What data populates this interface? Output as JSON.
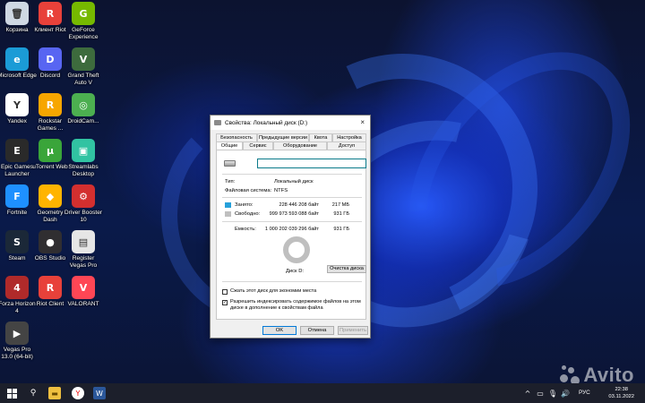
{
  "desktop": {
    "icons": [
      {
        "label": "Корзина",
        "glyph": "🗑",
        "color": "#cfd8e3",
        "icon": "recycle-bin-icon"
      },
      {
        "label": "Клиент Riot",
        "glyph": "R",
        "color": "#e8413a",
        "icon": "riot-client-icon"
      },
      {
        "label": "GeForce Experience",
        "glyph": "G",
        "color": "#76b900",
        "icon": "geforce-icon"
      },
      {
        "label": "Microsoft Edge",
        "glyph": "e",
        "color": "#1b9bd6",
        "icon": "edge-icon"
      },
      {
        "label": "Discord",
        "glyph": "D",
        "color": "#5865f2",
        "icon": "discord-icon"
      },
      {
        "label": "Grand Theft Auto V",
        "glyph": "V",
        "color": "#3d6b3d",
        "icon": "gta-icon"
      },
      {
        "label": "Yandex",
        "glyph": "Y",
        "color": "#ffffff",
        "icon": "yandex-icon"
      },
      {
        "label": "Rockstar Games ...",
        "glyph": "R",
        "color": "#f7a600",
        "icon": "rockstar-icon"
      },
      {
        "label": "DroidCam...",
        "glyph": "◎",
        "color": "#4caf50",
        "icon": "droidcam-icon"
      },
      {
        "label": "Epic Games Launcher",
        "glyph": "E",
        "color": "#2a2a2a",
        "icon": "epic-games-icon"
      },
      {
        "label": "uTorrent Web",
        "glyph": "µ",
        "color": "#3aa53a",
        "icon": "utorrent-icon"
      },
      {
        "label": "Streamlabs Desktop",
        "glyph": "▣",
        "color": "#31c3a2",
        "icon": "streamlabs-icon"
      },
      {
        "label": "Fortnite",
        "glyph": "F",
        "color": "#1e90ff",
        "icon": "fortnite-icon"
      },
      {
        "label": "Geometry Dash",
        "glyph": "◆",
        "color": "#ffb400",
        "icon": "geometry-dash-icon"
      },
      {
        "label": "Driver Booster 10",
        "glyph": "⚙",
        "color": "#d32f2f",
        "icon": "driver-booster-icon"
      },
      {
        "label": "Steam",
        "glyph": "S",
        "color": "#1b2838",
        "icon": "steam-icon"
      },
      {
        "label": "OBS Studio",
        "glyph": "●",
        "color": "#302e31",
        "icon": "obs-icon"
      },
      {
        "label": "Register Vegas Pro",
        "glyph": "▤",
        "color": "#e6e6e6",
        "icon": "register-vegas-icon"
      },
      {
        "label": "Forza Horizon 4",
        "glyph": "4",
        "color": "#b02a2a",
        "icon": "forza-icon"
      },
      {
        "label": "Riot Client",
        "glyph": "R",
        "color": "#e8413a",
        "icon": "riot-client-icon"
      },
      {
        "label": "VALORANT",
        "glyph": "V",
        "color": "#ff4655",
        "icon": "valorant-icon"
      },
      {
        "label": "Vegas Pro 13.0 (64-bit)",
        "glyph": "▶",
        "color": "#444444",
        "icon": "vegas-pro-icon"
      }
    ]
  },
  "dialog": {
    "title": "Свойства: Локальный диск (D:)",
    "close": "×",
    "tabs_row1": [
      "Безопасность",
      "Предыдущие версии",
      "Квота",
      "Настройка"
    ],
    "tabs_row2": [
      "Общие",
      "Сервис",
      "Оборудование",
      "Доступ"
    ],
    "active_tab": "Общие",
    "name_value": "",
    "type_label": "Тип:",
    "type_value": "Локальный диск",
    "fs_label": "Файловая система:",
    "fs_value": "NTFS",
    "used_label": "Занято:",
    "used_bytes": "228 446 208 байт",
    "used_size": "217 МБ",
    "free_label": "Свободно:",
    "free_bytes": "999 973 593 088 байт",
    "free_size": "931 ГБ",
    "capacity_label": "Емкость:",
    "capacity_bytes": "1 000 202 039 296 байт",
    "capacity_size": "931 ГБ",
    "disk_label": "Диск D:",
    "cleanup_button": "Очистка диска",
    "compress_label": "Сжать этот диск для экономии места",
    "compress_checked": false,
    "index_label": "Разрешить индексировать содержимое файлов на этом диске в дополнение к свойствам файла",
    "index_checked": true,
    "ok_button": "OK",
    "cancel_button": "Отмена",
    "apply_button": "Применить",
    "used_color": "#26a0da",
    "free_color": "#bfbfbf",
    "used_fraction": 0.0002
  },
  "taskbar": {
    "language": "РУС",
    "time": "22:38",
    "date": "03.11.2022"
  },
  "watermark": "Avito"
}
